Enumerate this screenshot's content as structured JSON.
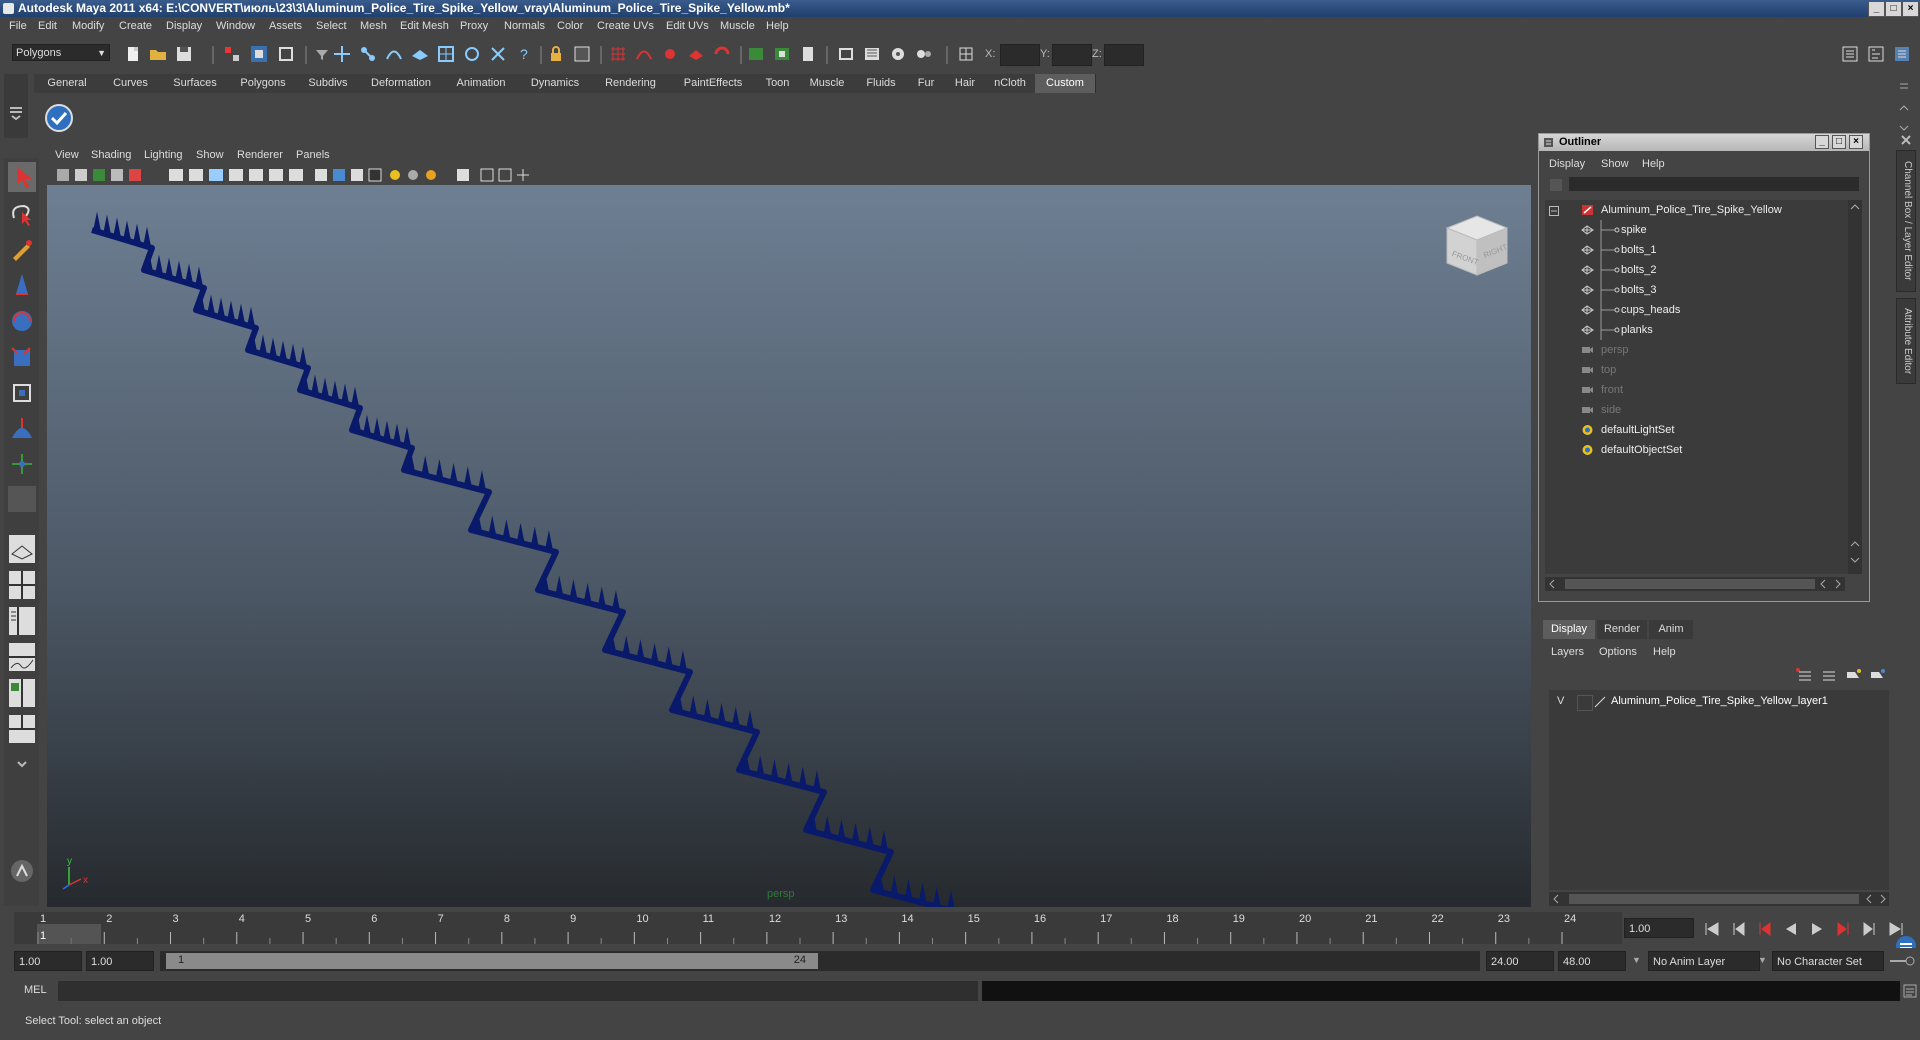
{
  "window": {
    "title": "Autodesk Maya 2011 x64: E:\\CONVERT\\июль\\23\\3\\Aluminum_Police_Tire_Spike_Yellow_vray\\Aluminum_Police_Tire_Spike_Yellow.mb*",
    "minimize": "_",
    "maximize": "□",
    "close": "×"
  },
  "menus": [
    "File",
    "Edit",
    "Modify",
    "Create",
    "Display",
    "Window",
    "Assets",
    "Select",
    "Mesh",
    "Edit Mesh",
    "Proxy",
    "Normals",
    "Color",
    "Create UVs",
    "Edit UVs",
    "Muscle",
    "Help"
  ],
  "status": {
    "mode": "Polygons",
    "x_label": "X:",
    "y_label": "Y:",
    "z_label": "Z:"
  },
  "shelf": {
    "tabs": [
      "General",
      "Curves",
      "Surfaces",
      "Polygons",
      "Subdivs",
      "Deformation",
      "Animation",
      "Dynamics",
      "Rendering",
      "PaintEffects",
      "Toon",
      "Muscle",
      "Fluids",
      "Fur",
      "Hair",
      "nCloth",
      "Custom"
    ],
    "active_tab": "Custom"
  },
  "viewport": {
    "menus": [
      "View",
      "Shading",
      "Lighting",
      "Show",
      "Renderer",
      "Panels"
    ],
    "camera_label": "persp",
    "viewcube": {
      "front": "FRONT",
      "right": "RIGHT"
    },
    "axis": {
      "y": "y",
      "x": "x"
    },
    "model_color": "#0a1a6a"
  },
  "outliner": {
    "title": "Outliner",
    "menus": [
      "Display",
      "Show",
      "Help"
    ],
    "items": [
      {
        "label": "Aluminum_Police_Tire_Spike_Yellow",
        "icon": "transform-icon",
        "dim": false,
        "indent": 0
      },
      {
        "label": "spike",
        "icon": "mesh-icon",
        "dim": false,
        "indent": 1
      },
      {
        "label": "bolts_1",
        "icon": "mesh-icon",
        "dim": false,
        "indent": 1
      },
      {
        "label": "bolts_2",
        "icon": "mesh-icon",
        "dim": false,
        "indent": 1
      },
      {
        "label": "bolts_3",
        "icon": "mesh-icon",
        "dim": false,
        "indent": 1
      },
      {
        "label": "cups_heads",
        "icon": "mesh-icon",
        "dim": false,
        "indent": 1
      },
      {
        "label": "planks",
        "icon": "mesh-icon",
        "dim": false,
        "indent": 1
      },
      {
        "label": "persp",
        "icon": "camera-icon",
        "dim": true,
        "indent": 0
      },
      {
        "label": "top",
        "icon": "camera-icon",
        "dim": true,
        "indent": 0
      },
      {
        "label": "front",
        "icon": "camera-icon",
        "dim": true,
        "indent": 0
      },
      {
        "label": "side",
        "icon": "camera-icon",
        "dim": true,
        "indent": 0
      },
      {
        "label": "defaultLightSet",
        "icon": "set-icon",
        "dim": false,
        "indent": 0
      },
      {
        "label": "defaultObjectSet",
        "icon": "set-icon",
        "dim": false,
        "indent": 0
      }
    ]
  },
  "side_tabs": [
    "Channel Box / Layer Editor",
    "Attribute Editor"
  ],
  "layer_editor": {
    "tabs": [
      "Display",
      "Render",
      "Anim"
    ],
    "active_tab": "Display",
    "menus": [
      "Layers",
      "Options",
      "Help"
    ],
    "layers": [
      {
        "visible": "V",
        "name": "Aluminum_Police_Tire_Spike_Yellow_layer1"
      }
    ]
  },
  "time_slider": {
    "ticks": [
      "1",
      "2",
      "3",
      "4",
      "5",
      "6",
      "7",
      "8",
      "9",
      "10",
      "11",
      "12",
      "13",
      "14",
      "15",
      "16",
      "17",
      "18",
      "19",
      "20",
      "21",
      "22",
      "23",
      "24"
    ],
    "current_frame_marker": "1",
    "current_time": "1.00"
  },
  "range_slider": {
    "start_time": "1.00",
    "playback_start": "1.00",
    "range_start_label": "1",
    "range_end_label": "24",
    "playback_end": "24.00",
    "end_time": "48.00",
    "anim_layer": "No Anim Layer",
    "character_set": "No Character Set"
  },
  "command_line": {
    "label": "MEL"
  },
  "help_line": {
    "text": "Select Tool: select an object"
  }
}
